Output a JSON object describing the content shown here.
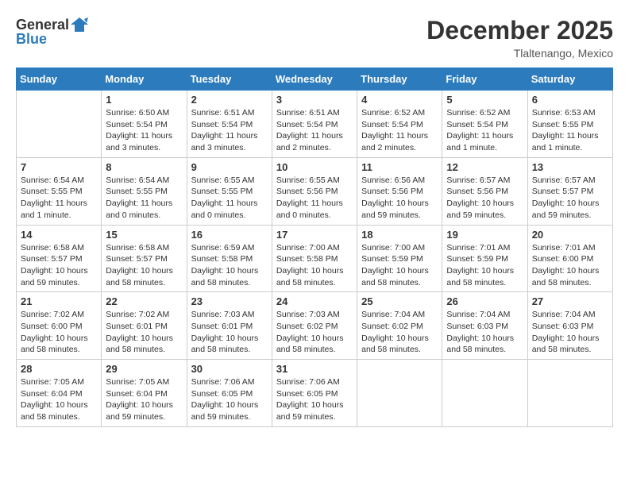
{
  "header": {
    "logo": {
      "general": "General",
      "blue": "Blue"
    },
    "title": "December 2025",
    "location": "Tlaltenango, Mexico"
  },
  "calendar": {
    "days_of_week": [
      "Sunday",
      "Monday",
      "Tuesday",
      "Wednesday",
      "Thursday",
      "Friday",
      "Saturday"
    ],
    "weeks": [
      [
        {
          "day": "",
          "info": ""
        },
        {
          "day": "1",
          "info": "Sunrise: 6:50 AM\nSunset: 5:54 PM\nDaylight: 11 hours\nand 3 minutes."
        },
        {
          "day": "2",
          "info": "Sunrise: 6:51 AM\nSunset: 5:54 PM\nDaylight: 11 hours\nand 3 minutes."
        },
        {
          "day": "3",
          "info": "Sunrise: 6:51 AM\nSunset: 5:54 PM\nDaylight: 11 hours\nand 2 minutes."
        },
        {
          "day": "4",
          "info": "Sunrise: 6:52 AM\nSunset: 5:54 PM\nDaylight: 11 hours\nand 2 minutes."
        },
        {
          "day": "5",
          "info": "Sunrise: 6:52 AM\nSunset: 5:54 PM\nDaylight: 11 hours\nand 1 minute."
        },
        {
          "day": "6",
          "info": "Sunrise: 6:53 AM\nSunset: 5:55 PM\nDaylight: 11 hours\nand 1 minute."
        }
      ],
      [
        {
          "day": "7",
          "info": "Sunrise: 6:54 AM\nSunset: 5:55 PM\nDaylight: 11 hours\nand 1 minute."
        },
        {
          "day": "8",
          "info": "Sunrise: 6:54 AM\nSunset: 5:55 PM\nDaylight: 11 hours\nand 0 minutes."
        },
        {
          "day": "9",
          "info": "Sunrise: 6:55 AM\nSunset: 5:55 PM\nDaylight: 11 hours\nand 0 minutes."
        },
        {
          "day": "10",
          "info": "Sunrise: 6:55 AM\nSunset: 5:56 PM\nDaylight: 11 hours\nand 0 minutes."
        },
        {
          "day": "11",
          "info": "Sunrise: 6:56 AM\nSunset: 5:56 PM\nDaylight: 10 hours\nand 59 minutes."
        },
        {
          "day": "12",
          "info": "Sunrise: 6:57 AM\nSunset: 5:56 PM\nDaylight: 10 hours\nand 59 minutes."
        },
        {
          "day": "13",
          "info": "Sunrise: 6:57 AM\nSunset: 5:57 PM\nDaylight: 10 hours\nand 59 minutes."
        }
      ],
      [
        {
          "day": "14",
          "info": "Sunrise: 6:58 AM\nSunset: 5:57 PM\nDaylight: 10 hours\nand 59 minutes."
        },
        {
          "day": "15",
          "info": "Sunrise: 6:58 AM\nSunset: 5:57 PM\nDaylight: 10 hours\nand 58 minutes."
        },
        {
          "day": "16",
          "info": "Sunrise: 6:59 AM\nSunset: 5:58 PM\nDaylight: 10 hours\nand 58 minutes."
        },
        {
          "day": "17",
          "info": "Sunrise: 7:00 AM\nSunset: 5:58 PM\nDaylight: 10 hours\nand 58 minutes."
        },
        {
          "day": "18",
          "info": "Sunrise: 7:00 AM\nSunset: 5:59 PM\nDaylight: 10 hours\nand 58 minutes."
        },
        {
          "day": "19",
          "info": "Sunrise: 7:01 AM\nSunset: 5:59 PM\nDaylight: 10 hours\nand 58 minutes."
        },
        {
          "day": "20",
          "info": "Sunrise: 7:01 AM\nSunset: 6:00 PM\nDaylight: 10 hours\nand 58 minutes."
        }
      ],
      [
        {
          "day": "21",
          "info": "Sunrise: 7:02 AM\nSunset: 6:00 PM\nDaylight: 10 hours\nand 58 minutes."
        },
        {
          "day": "22",
          "info": "Sunrise: 7:02 AM\nSunset: 6:01 PM\nDaylight: 10 hours\nand 58 minutes."
        },
        {
          "day": "23",
          "info": "Sunrise: 7:03 AM\nSunset: 6:01 PM\nDaylight: 10 hours\nand 58 minutes."
        },
        {
          "day": "24",
          "info": "Sunrise: 7:03 AM\nSunset: 6:02 PM\nDaylight: 10 hours\nand 58 minutes."
        },
        {
          "day": "25",
          "info": "Sunrise: 7:04 AM\nSunset: 6:02 PM\nDaylight: 10 hours\nand 58 minutes."
        },
        {
          "day": "26",
          "info": "Sunrise: 7:04 AM\nSunset: 6:03 PM\nDaylight: 10 hours\nand 58 minutes."
        },
        {
          "day": "27",
          "info": "Sunrise: 7:04 AM\nSunset: 6:03 PM\nDaylight: 10 hours\nand 58 minutes."
        }
      ],
      [
        {
          "day": "28",
          "info": "Sunrise: 7:05 AM\nSunset: 6:04 PM\nDaylight: 10 hours\nand 58 minutes."
        },
        {
          "day": "29",
          "info": "Sunrise: 7:05 AM\nSunset: 6:04 PM\nDaylight: 10 hours\nand 59 minutes."
        },
        {
          "day": "30",
          "info": "Sunrise: 7:06 AM\nSunset: 6:05 PM\nDaylight: 10 hours\nand 59 minutes."
        },
        {
          "day": "31",
          "info": "Sunrise: 7:06 AM\nSunset: 6:05 PM\nDaylight: 10 hours\nand 59 minutes."
        },
        {
          "day": "",
          "info": ""
        },
        {
          "day": "",
          "info": ""
        },
        {
          "day": "",
          "info": ""
        }
      ]
    ]
  }
}
